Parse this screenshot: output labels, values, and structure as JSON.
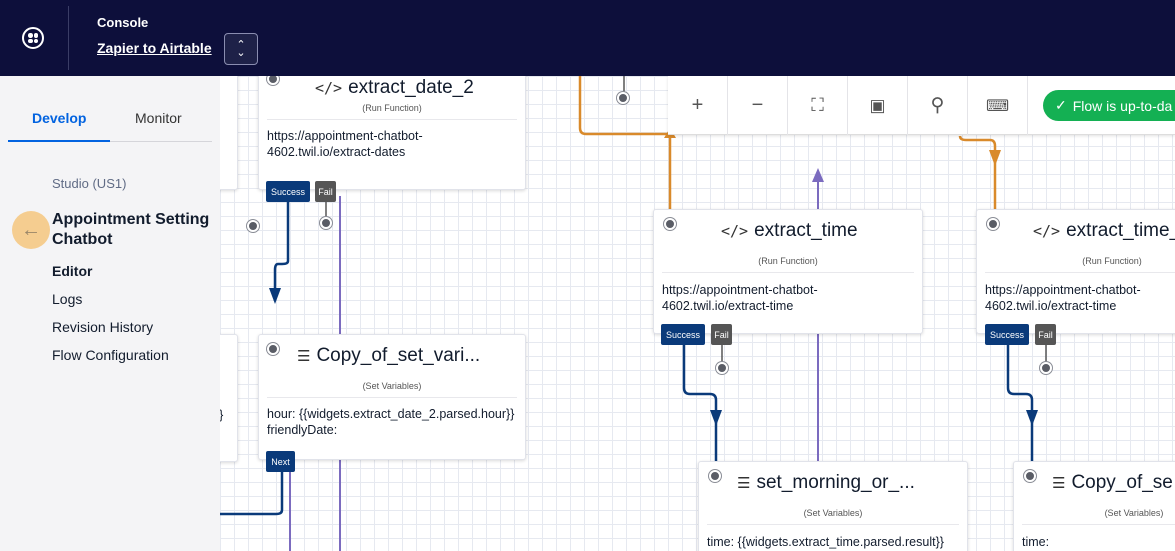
{
  "topbar": {
    "console_label": "Console",
    "account_name": "Zapier to Airtable",
    "switch_icon": "chevron-up-down-icon"
  },
  "sidebar": {
    "tabs": [
      {
        "label": "Develop",
        "active": true
      },
      {
        "label": "Monitor",
        "active": false
      }
    ],
    "region": "Studio (US1)",
    "flow_title": "Appointment Setting Chatbot",
    "nav": [
      {
        "label": "Editor",
        "active": true
      },
      {
        "label": "Logs"
      },
      {
        "label": "Revision History"
      },
      {
        "label": "Flow Configuration"
      }
    ]
  },
  "toolbar": {
    "buttons": [
      "+",
      "−",
      "fit-screen-icon",
      "bookmark-icon",
      "search-icon",
      "keyboard-icon"
    ],
    "status": "Flow is up-to-da"
  },
  "widgets": {
    "extract_date_2": {
      "name": "extract_date_2",
      "type": "(Run Function)",
      "body_1": "https://appointment-chatbot-",
      "body_2": "4602.twil.io/extract-dates",
      "success": "Success",
      "fail": "Fail"
    },
    "copy_of_set_vari": {
      "name": "Copy_of_set_vari...",
      "type": "(Set Variables)",
      "body_1": "hour: {{widgets.extract_date_2.parsed.hour}}",
      "body_2": "friendlyDate:",
      "next": "Next"
    },
    "extract_time": {
      "name": "extract_time",
      "type": "(Run Function)",
      "body_1": "https://appointment-chatbot-",
      "body_2": "4602.twil.io/extract-time",
      "success": "Success",
      "fail": "Fail"
    },
    "extract_time_2": {
      "name": "extract_time_",
      "type": "(Run Function)",
      "body_1": "https://appointment-chatbot-",
      "body_2": "4602.twil.io/extract-time",
      "success": "Success",
      "fail": "Fail"
    },
    "set_morning": {
      "name": "set_morning_or_...",
      "type": "(Set Variables)",
      "body_1": "time: {{widgets.extract_time.parsed.result}}"
    },
    "copy_of_se": {
      "name": "Copy_of_se",
      "type": "(Set Variables)",
      "body_1": "time:"
    },
    "left_partial": {
      "body_1": "}}"
    }
  },
  "colors": {
    "topbar": "#0d0f3b",
    "accent": "#0263e0",
    "status_green": "#14b053",
    "wire_blue": "#0a3a7a",
    "wire_orange": "#d98a2b",
    "wire_purple": "#7b6bbf"
  }
}
